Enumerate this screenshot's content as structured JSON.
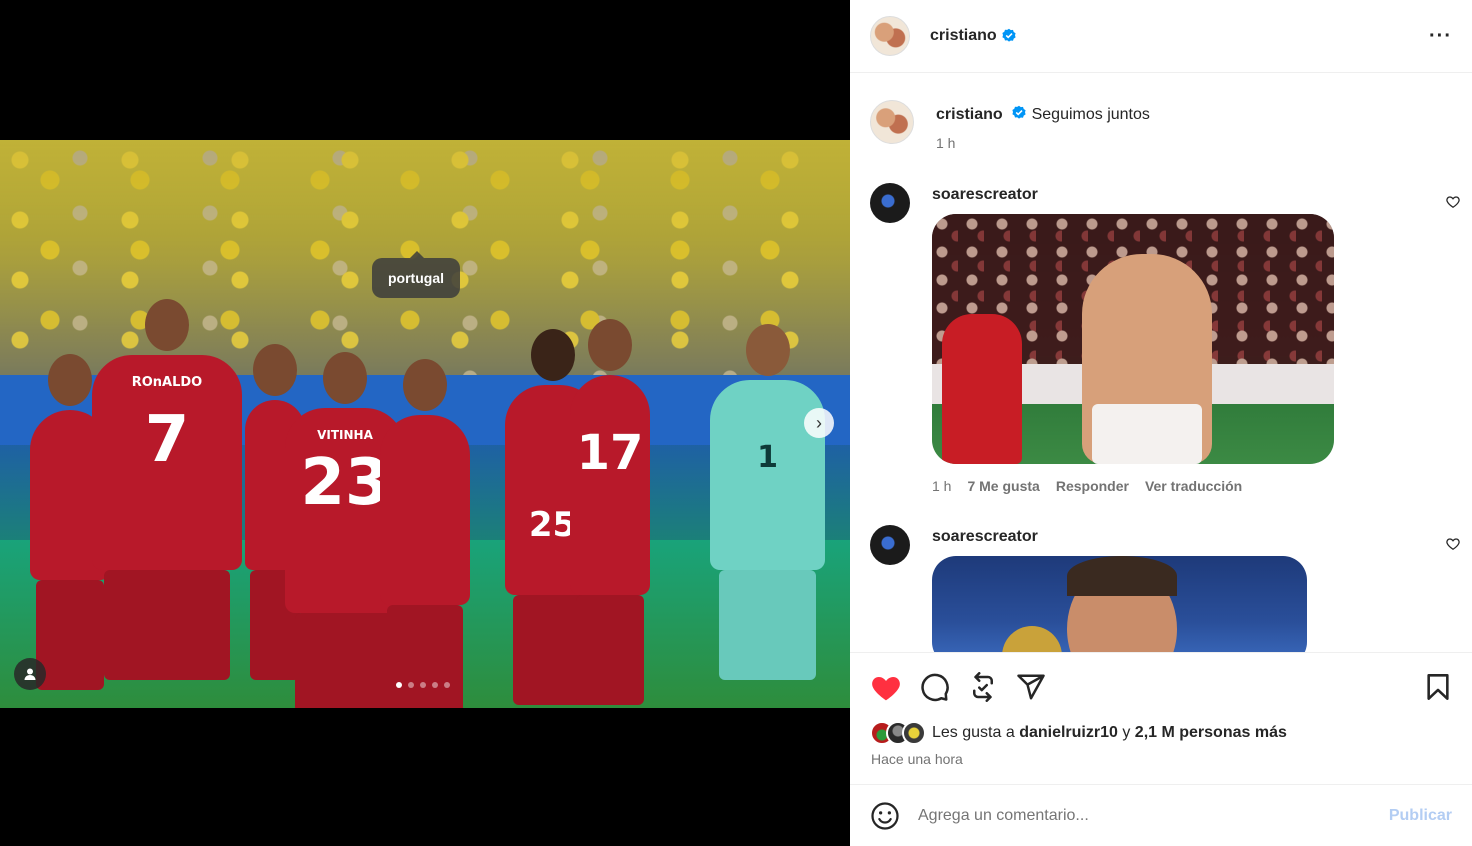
{
  "post": {
    "author": "cristiano",
    "caption": "Seguimos juntos",
    "caption_time": "1 h",
    "photo_tag": "portugal",
    "carousel_count": 5,
    "carousel_active": 0,
    "jersey_numbers": [
      "ROnALDO",
      "7",
      "23",
      "VITINHA",
      "17",
      "25",
      "1"
    ]
  },
  "comments": [
    {
      "user": "soarescreator",
      "time": "1 h",
      "likes": "7 Me gusta",
      "reply": "Responder",
      "translate": "Ver traducción"
    },
    {
      "user": "soarescreator"
    }
  ],
  "likes": {
    "prefix": "Les gusta a",
    "user": "danielruizr10",
    "conj": "y",
    "others": "2,1 M personas más",
    "time_ago": "Hace una hora"
  },
  "comment_box": {
    "placeholder": "Agrega un comentario...",
    "publish": "Publicar"
  },
  "colors": {
    "like_red": "#ff3040",
    "verified_blue": "#0095f6",
    "publish_disabled": "#b3cdf3"
  },
  "icons": {
    "header_more": "more-icon",
    "like": "heart-filled-icon",
    "comment": "comment-icon",
    "repost": "repost-icon",
    "share": "send-icon",
    "save": "bookmark-icon",
    "emoji": "emoji-icon"
  }
}
